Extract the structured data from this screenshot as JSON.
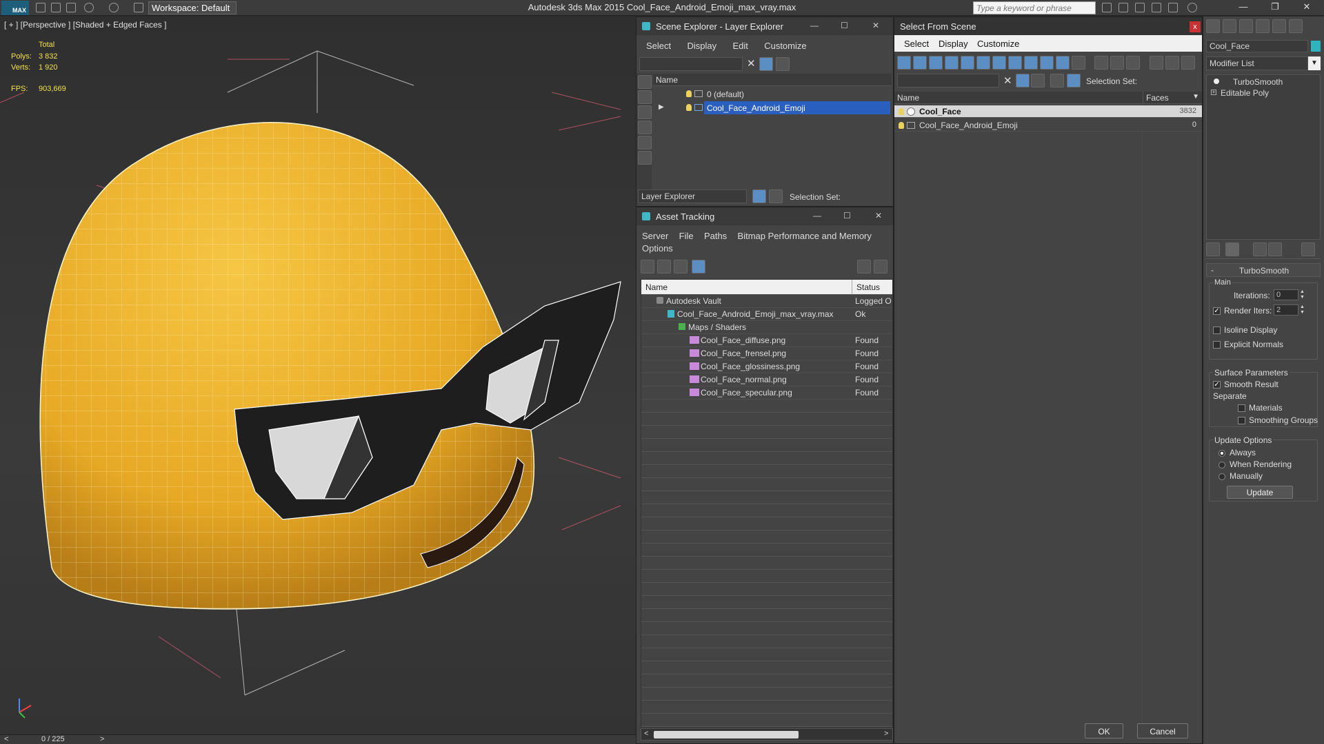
{
  "titlebar": {
    "logo": "MAX",
    "workspace": "Workspace: Default",
    "title": "Autodesk 3ds Max 2015    Cool_Face_Android_Emoji_max_vray.max",
    "search_placeholder": "Type a keyword or phrase"
  },
  "viewport": {
    "label": "[ + ] [Perspective ] [Shaded + Edged Faces ]",
    "stats": {
      "total": "Total",
      "polys_label": "Polys:",
      "polys": "3 832",
      "verts_label": "Verts:",
      "verts": "1 920",
      "fps_label": "FPS:",
      "fps": "903,669"
    },
    "timeline": "0 / 225"
  },
  "scene_explorer": {
    "title": "Scene Explorer - Layer Explorer",
    "menu": [
      "Select",
      "Display",
      "Edit",
      "Customize"
    ],
    "col_name": "Name",
    "layers": [
      "0 (default)",
      "Cool_Face_Android_Emoji"
    ],
    "footer_dropdown": "Layer Explorer",
    "selection_set": "Selection Set:"
  },
  "asset_tracking": {
    "title": "Asset Tracking",
    "menu": [
      "Server",
      "File",
      "Paths",
      "Bitmap Performance and Memory"
    ],
    "menu2": "Options",
    "col_name": "Name",
    "col_status": "Status",
    "rows": [
      {
        "name": "Autodesk Vault",
        "status": "Logged O"
      },
      {
        "name": "Cool_Face_Android_Emoji_max_vray.max",
        "status": "Ok"
      },
      {
        "name": "Maps / Shaders",
        "status": ""
      },
      {
        "name": "Cool_Face_diffuse.png",
        "status": "Found"
      },
      {
        "name": "Cool_Face_frensel.png",
        "status": "Found"
      },
      {
        "name": "Cool_Face_glossiness.png",
        "status": "Found"
      },
      {
        "name": "Cool_Face_normal.png",
        "status": "Found"
      },
      {
        "name": "Cool_Face_specular.png",
        "status": "Found"
      }
    ]
  },
  "select_from_scene": {
    "title": "Select From Scene",
    "menu": [
      "Select",
      "Display",
      "Customize"
    ],
    "selection_set": "Selection Set:",
    "col_name": "Name",
    "col_faces": "Faces",
    "rows": [
      {
        "name": "Cool_Face",
        "faces": "3832"
      },
      {
        "name": "Cool_Face_Android_Emoji",
        "faces": "0"
      }
    ],
    "ok": "OK",
    "cancel": "Cancel"
  },
  "command_panel": {
    "object_name": "Cool_Face",
    "modifier_list": "Modifier List",
    "stack": [
      "TurboSmooth",
      "Editable Poly"
    ],
    "rollout": "TurboSmooth",
    "main": "Main",
    "iterations_label": "Iterations:",
    "iterations": "0",
    "render_iters_label": "Render Iters:",
    "render_iters": "2",
    "isoline": "Isoline Display",
    "explicit_normals": "Explicit Normals",
    "surface_params": "Surface Parameters",
    "smooth_result": "Smooth Result",
    "separate": "Separate",
    "materials": "Materials",
    "smoothing_groups": "Smoothing Groups",
    "update_options": "Update Options",
    "always": "Always",
    "when_rendering": "When Rendering",
    "manually": "Manually",
    "update_btn": "Update"
  }
}
